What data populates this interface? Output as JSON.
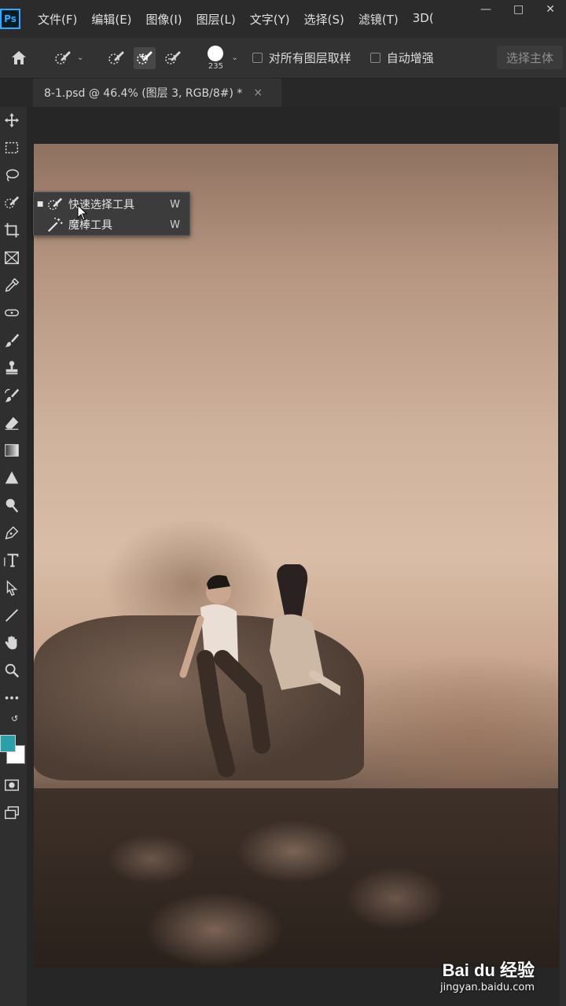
{
  "app": {
    "logo": "Ps"
  },
  "menu": [
    "文件(F)",
    "编辑(E)",
    "图像(I)",
    "图层(L)",
    "文字(Y)",
    "选择(S)",
    "滤镜(T)",
    "3D("
  ],
  "options": {
    "brush_size": "235",
    "sample_all_layers": "对所有图层取样",
    "auto_enhance": "自动增强",
    "select_subject": "选择主体"
  },
  "document_tab": {
    "title": "8-1.psd @ 46.4% (图层 3, RGB/8#) *",
    "close": "×"
  },
  "flyout": {
    "items": [
      {
        "label": "快速选择工具",
        "shortcut": "W",
        "active": true
      },
      {
        "label": "魔棒工具",
        "shortcut": "W",
        "active": false
      }
    ]
  },
  "colors": {
    "foreground": "#2aa0a8",
    "background": "#ffffff"
  },
  "watermark": {
    "logo": "Bai du 经验",
    "url": "jingyan.baidu.com"
  }
}
